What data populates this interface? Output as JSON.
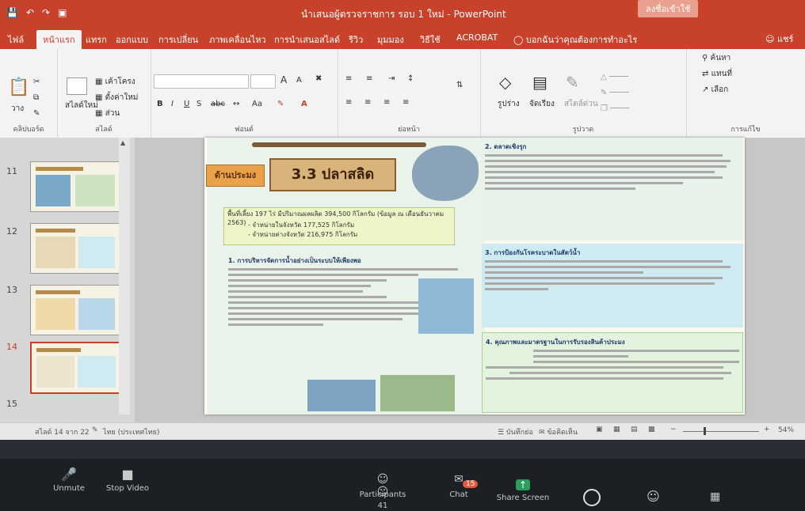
{
  "app": {
    "title": "นำเสนอผู้ตรวจราชการ รอบ 1 ใหม่  -  PowerPoint",
    "signin": "ลงชื่อเข้าใช้",
    "user": "แชร์"
  },
  "tabs": [
    "ไฟล์",
    "หน้าแรก",
    "แทรก",
    "ออกแบบ",
    "การเปลี่ยน",
    "ภาพเคลื่อนไหว",
    "การนำเสนอสไลด์",
    "รีวิว",
    "มุมมอง",
    "วิธีใช้",
    "ACROBAT"
  ],
  "tell_me": "บอกฉันว่าคุณต้องการทำอะไร",
  "ribbon": {
    "clipboard": {
      "paste": "วาง",
      "label": "คลิปบอร์ด"
    },
    "slides": {
      "new_slide": "สไลด์ใหม่",
      "layout": "เค้าโครง",
      "reset": "ตั้งค่าใหม่",
      "section": "ส่วน",
      "label": "สไลด์"
    },
    "font": {
      "label": "ฟอนต์",
      "bold": "B",
      "italic": "I",
      "underline": "U",
      "strike": "S",
      "grow": "A",
      "shrink": "A"
    },
    "paragraph": {
      "label": "ย่อหน้า"
    },
    "drawing": {
      "shapes": "รูปร่าง",
      "arrange": "จัดเรียง",
      "styles": "สไตล์ด่วน",
      "label": "รูปวาด"
    },
    "editing": {
      "find": "ค้นหา",
      "replace": "แทนที่",
      "select": "เลือก",
      "label": "การแก้ไข"
    }
  },
  "thumbnails": [
    {
      "num": "11"
    },
    {
      "num": "12"
    },
    {
      "num": "13"
    },
    {
      "num": "14"
    },
    {
      "num": "15"
    }
  ],
  "slide": {
    "tag": "ด้านประมง",
    "title": "3.3 ปลาสลิด",
    "summary_line1": "พื้นที่เลี้ยง 197 ไร่ มีปริมาณผลผลิต 394,500 กิโลกรัม (ข้อมูล ณ เดือนธันวาคม 2563)",
    "summary_line2": "- จำหน่ายในจังหวัด 177,525 กิโลกรัม",
    "summary_line3": "- จำหน่ายต่างจังหวัด 216,975 กิโลกรัม",
    "s1_head": "1. การบริหารจัดการน้ำอย่างเป็นระบบให้เพียงพอ",
    "s2_head": "2. ตลาดเชิงรุก",
    "s3_head": "3. การป้องกันโรคระบาดในสัตว์น้ำ",
    "s4_head": "4. คุณภาพและมาตรฐานในการรับรองสินค้าประมง"
  },
  "status": {
    "slide_of": "สไลด์ 14 จาก 22",
    "language": "ไทย (ประเทศไทย)",
    "notes": "บันทึกย่อ",
    "comments": "ข้อคิดเห็น",
    "zoom": "54%"
  },
  "zoom_bar": {
    "unmute": "Unmute",
    "stop_video": "Stop Video",
    "participants": "Participants",
    "participants_count": "41",
    "chat": "Chat",
    "chat_badge": "15",
    "share": "Share Screen"
  },
  "colors": {
    "accent": "#c8412a",
    "zoom_bg": "#1c1f24",
    "slide_teal": "#cfeaf0"
  }
}
